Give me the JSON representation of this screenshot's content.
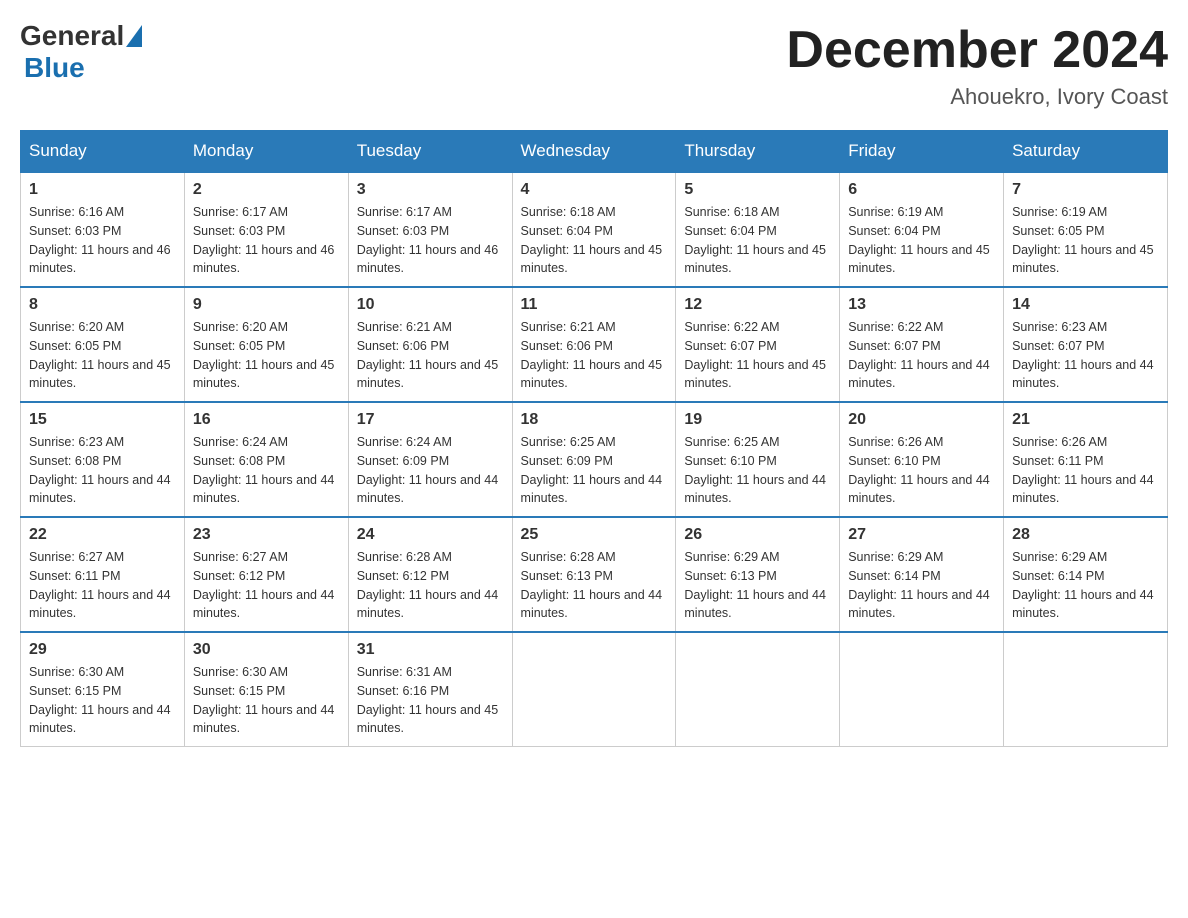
{
  "header": {
    "logo": {
      "general": "General",
      "blue": "Blue"
    },
    "title": "December 2024",
    "location": "Ahouekro, Ivory Coast"
  },
  "days_of_week": [
    "Sunday",
    "Monday",
    "Tuesday",
    "Wednesday",
    "Thursday",
    "Friday",
    "Saturday"
  ],
  "weeks": [
    [
      {
        "day": 1,
        "sunrise": "6:16 AM",
        "sunset": "6:03 PM",
        "daylight": "11 hours and 46 minutes."
      },
      {
        "day": 2,
        "sunrise": "6:17 AM",
        "sunset": "6:03 PM",
        "daylight": "11 hours and 46 minutes."
      },
      {
        "day": 3,
        "sunrise": "6:17 AM",
        "sunset": "6:03 PM",
        "daylight": "11 hours and 46 minutes."
      },
      {
        "day": 4,
        "sunrise": "6:18 AM",
        "sunset": "6:04 PM",
        "daylight": "11 hours and 45 minutes."
      },
      {
        "day": 5,
        "sunrise": "6:18 AM",
        "sunset": "6:04 PM",
        "daylight": "11 hours and 45 minutes."
      },
      {
        "day": 6,
        "sunrise": "6:19 AM",
        "sunset": "6:04 PM",
        "daylight": "11 hours and 45 minutes."
      },
      {
        "day": 7,
        "sunrise": "6:19 AM",
        "sunset": "6:05 PM",
        "daylight": "11 hours and 45 minutes."
      }
    ],
    [
      {
        "day": 8,
        "sunrise": "6:20 AM",
        "sunset": "6:05 PM",
        "daylight": "11 hours and 45 minutes."
      },
      {
        "day": 9,
        "sunrise": "6:20 AM",
        "sunset": "6:05 PM",
        "daylight": "11 hours and 45 minutes."
      },
      {
        "day": 10,
        "sunrise": "6:21 AM",
        "sunset": "6:06 PM",
        "daylight": "11 hours and 45 minutes."
      },
      {
        "day": 11,
        "sunrise": "6:21 AM",
        "sunset": "6:06 PM",
        "daylight": "11 hours and 45 minutes."
      },
      {
        "day": 12,
        "sunrise": "6:22 AM",
        "sunset": "6:07 PM",
        "daylight": "11 hours and 45 minutes."
      },
      {
        "day": 13,
        "sunrise": "6:22 AM",
        "sunset": "6:07 PM",
        "daylight": "11 hours and 44 minutes."
      },
      {
        "day": 14,
        "sunrise": "6:23 AM",
        "sunset": "6:07 PM",
        "daylight": "11 hours and 44 minutes."
      }
    ],
    [
      {
        "day": 15,
        "sunrise": "6:23 AM",
        "sunset": "6:08 PM",
        "daylight": "11 hours and 44 minutes."
      },
      {
        "day": 16,
        "sunrise": "6:24 AM",
        "sunset": "6:08 PM",
        "daylight": "11 hours and 44 minutes."
      },
      {
        "day": 17,
        "sunrise": "6:24 AM",
        "sunset": "6:09 PM",
        "daylight": "11 hours and 44 minutes."
      },
      {
        "day": 18,
        "sunrise": "6:25 AM",
        "sunset": "6:09 PM",
        "daylight": "11 hours and 44 minutes."
      },
      {
        "day": 19,
        "sunrise": "6:25 AM",
        "sunset": "6:10 PM",
        "daylight": "11 hours and 44 minutes."
      },
      {
        "day": 20,
        "sunrise": "6:26 AM",
        "sunset": "6:10 PM",
        "daylight": "11 hours and 44 minutes."
      },
      {
        "day": 21,
        "sunrise": "6:26 AM",
        "sunset": "6:11 PM",
        "daylight": "11 hours and 44 minutes."
      }
    ],
    [
      {
        "day": 22,
        "sunrise": "6:27 AM",
        "sunset": "6:11 PM",
        "daylight": "11 hours and 44 minutes."
      },
      {
        "day": 23,
        "sunrise": "6:27 AM",
        "sunset": "6:12 PM",
        "daylight": "11 hours and 44 minutes."
      },
      {
        "day": 24,
        "sunrise": "6:28 AM",
        "sunset": "6:12 PM",
        "daylight": "11 hours and 44 minutes."
      },
      {
        "day": 25,
        "sunrise": "6:28 AM",
        "sunset": "6:13 PM",
        "daylight": "11 hours and 44 minutes."
      },
      {
        "day": 26,
        "sunrise": "6:29 AM",
        "sunset": "6:13 PM",
        "daylight": "11 hours and 44 minutes."
      },
      {
        "day": 27,
        "sunrise": "6:29 AM",
        "sunset": "6:14 PM",
        "daylight": "11 hours and 44 minutes."
      },
      {
        "day": 28,
        "sunrise": "6:29 AM",
        "sunset": "6:14 PM",
        "daylight": "11 hours and 44 minutes."
      }
    ],
    [
      {
        "day": 29,
        "sunrise": "6:30 AM",
        "sunset": "6:15 PM",
        "daylight": "11 hours and 44 minutes."
      },
      {
        "day": 30,
        "sunrise": "6:30 AM",
        "sunset": "6:15 PM",
        "daylight": "11 hours and 44 minutes."
      },
      {
        "day": 31,
        "sunrise": "6:31 AM",
        "sunset": "6:16 PM",
        "daylight": "11 hours and 45 minutes."
      },
      null,
      null,
      null,
      null
    ]
  ],
  "labels": {
    "sunrise": "Sunrise:",
    "sunset": "Sunset:",
    "daylight": "Daylight:"
  }
}
